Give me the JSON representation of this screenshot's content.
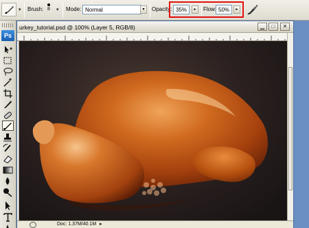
{
  "options_bar": {
    "brush_label": "Brush:",
    "brush_size": "8",
    "mode_label": "Mode:",
    "mode_value": "Normal",
    "opacity_label": "Opacity:",
    "opacity_value": "35%",
    "flow_label": "Flow:",
    "flow_value": "50%",
    "dropdown_glyph": "▾",
    "stepper_glyph": "▸",
    "tool_icon": "brush-icon",
    "airbrush_icon": "airbrush-icon",
    "highlight_color": "#e01010"
  },
  "toolbox": {
    "app_badge": "Ps",
    "tools": [
      {
        "name": "move-tool-icon"
      },
      {
        "name": "marquee-tool-icon"
      },
      {
        "name": "lasso-tool-icon"
      },
      {
        "name": "magic-wand-tool-icon"
      },
      {
        "name": "crop-tool-icon"
      },
      {
        "name": "slice-tool-icon"
      },
      {
        "name": "healing-brush-tool-icon"
      },
      {
        "name": "brush-tool-icon",
        "active": true
      },
      {
        "name": "clone-stamp-tool-icon"
      },
      {
        "name": "history-brush-tool-icon"
      },
      {
        "name": "eraser-tool-icon"
      },
      {
        "name": "gradient-tool-icon"
      },
      {
        "name": "blur-tool-icon"
      },
      {
        "name": "dodge-tool-icon"
      },
      {
        "name": "path-selection-tool-icon"
      },
      {
        "name": "type-tool-icon"
      },
      {
        "name": "pen-tool-icon"
      }
    ]
  },
  "document": {
    "title": "urkey_tutorial.psd @ 100% (Layer 5, RGB/8)",
    "minimize_glyph": "▁",
    "maximize_glyph": "□",
    "close_glyph": "✕",
    "status_info": "Doc: 1.37M/40.1M",
    "status_arrow": "▸",
    "canvas_bg": "#2b2120",
    "turkey_color": "#c4560f"
  }
}
